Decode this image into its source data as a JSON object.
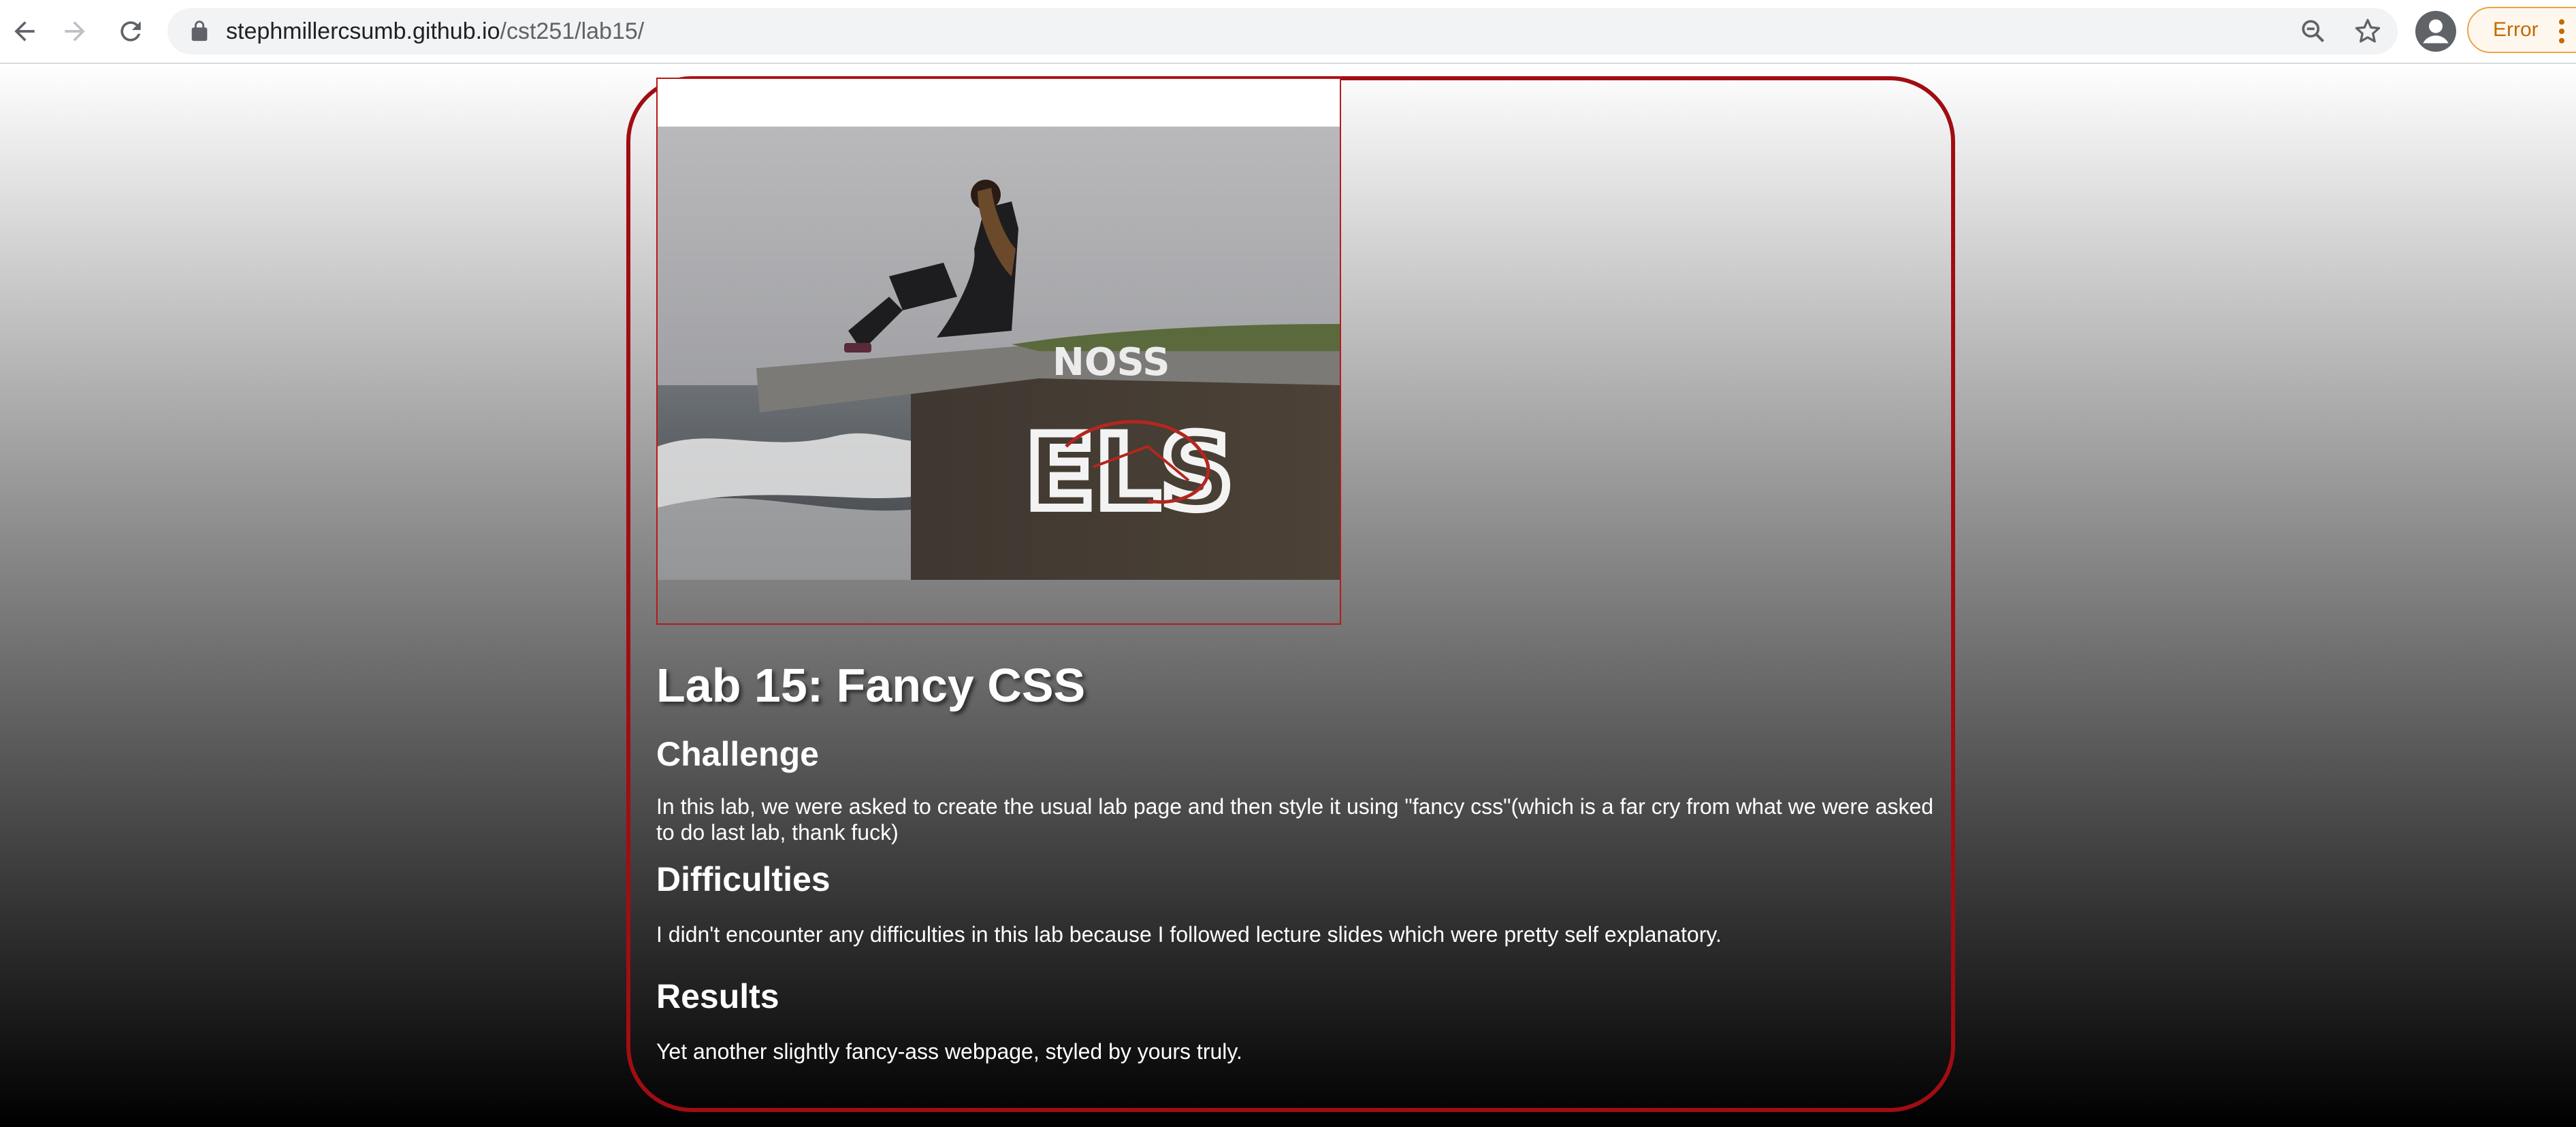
{
  "browser": {
    "url_host": "stephmillercsumb.github.io",
    "url_path": "/cst251/lab15/",
    "error_label": "Error",
    "back_icon": "arrow-left-icon",
    "forward_icon": "arrow-right-icon",
    "reload_icon": "reload-icon",
    "lock_icon": "lock-icon",
    "zoom_icon": "zoom-out-icon",
    "bookmark_icon": "star-icon",
    "profile_icon": "profile-icon",
    "menu_icon": "kebab-menu-icon"
  },
  "page": {
    "title": "Lab 15: Fancy CSS",
    "sections": [
      {
        "heading": "Challenge",
        "text": "In this lab, we were asked to create the usual lab page and then style it using \"fancy css\"(which is a far cry from what we were asked to do last lab, thank fuck)"
      },
      {
        "heading": "Difficulties",
        "text": "I didn't encounter any difficulties in this lab because I followed lecture slides which were pretty self explanatory."
      },
      {
        "heading": "Results",
        "text": "Yet another slightly fancy-ass webpage, styled by yours truly."
      }
    ],
    "border_color": "#a00d12",
    "gradient_top": "#ffffff",
    "gradient_bottom": "#000000"
  }
}
